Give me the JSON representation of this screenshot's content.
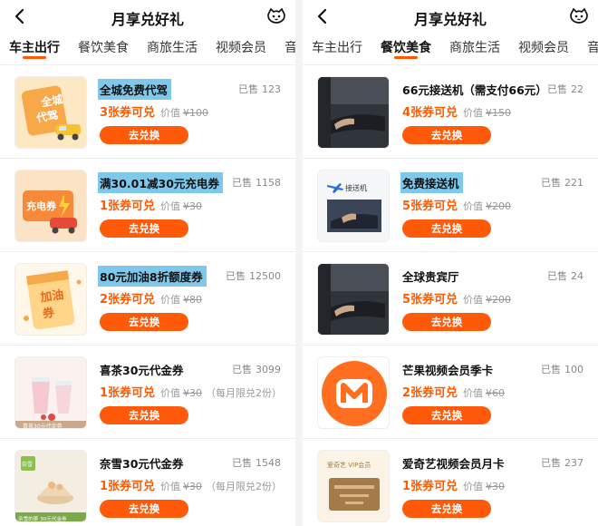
{
  "colors": {
    "accent": "#ff5a00",
    "highlight": "#7ec8ec"
  },
  "left": {
    "title": "月享兑好礼",
    "tabs": [
      "车主出行",
      "餐饮美食",
      "商旅生活",
      "视频会员",
      "音频"
    ],
    "active_tab": "车主出行",
    "items": [
      {
        "title": "全城免费代驾",
        "sold_label": "已售",
        "sold": "123",
        "coupons": "3张券可兑",
        "worth_label": "价值",
        "worth": "¥100",
        "limit": "",
        "button": "去兑换",
        "thumb_text": "全城代驾",
        "icon": "car-service-icon"
      },
      {
        "title": "满30.01减30元充电券",
        "sold_label": "已售",
        "sold": "1158",
        "coupons": "1张券可兑",
        "worth_label": "价值",
        "worth": "¥30",
        "limit": "",
        "button": "去兑换",
        "thumb_text": "充电券",
        "icon": "charging-coupon-icon"
      },
      {
        "title": "80元加油8折额度券",
        "sold_label": "已售",
        "sold": "12500",
        "coupons": "2张券可兑",
        "worth_label": "价值",
        "worth": "¥80",
        "limit": "",
        "button": "去兑换",
        "thumb_text": "加油券",
        "icon": "fuel-coupon-icon"
      },
      {
        "title": "喜茶30元代金券",
        "sold_label": "已售",
        "sold": "3099",
        "coupons": "1张券可兑",
        "worth_label": "价值",
        "worth": "¥30",
        "limit": "（每月限兑2份）",
        "button": "去兑换",
        "thumb_text": "喜茶30元代金券",
        "icon": "tea-drink-icon"
      },
      {
        "title": "奈雪30元代金券",
        "sold_label": "已售",
        "sold": "1548",
        "coupons": "1张券可兑",
        "worth_label": "价值",
        "worth": "¥30",
        "limit": "（每月限兑2份）",
        "button": "去兑换",
        "thumb_text": "奈雪的茶 30元代金券",
        "icon": "cake-icon"
      }
    ]
  },
  "right": {
    "title": "月享兑好礼",
    "tabs": [
      "车主出行",
      "餐饮美食",
      "商旅生活",
      "视频会员",
      "音频"
    ],
    "active_tab": "餐饮美食",
    "items": [
      {
        "title": "66元接送机（需支付66元）",
        "sold_label": "已售",
        "sold": "22",
        "coupons": "4张券可兑",
        "worth_label": "价值",
        "worth": "¥150",
        "limit": "",
        "button": "去兑换",
        "thumb_text": "",
        "icon": "car-door-icon"
      },
      {
        "title": "免费接送机",
        "sold_label": "已售",
        "sold": "221",
        "coupons": "5张券可兑",
        "worth_label": "价值",
        "worth": "¥200",
        "limit": "",
        "button": "去兑换",
        "thumb_text": "接送机",
        "icon": "airport-transfer-icon"
      },
      {
        "title": "全球贵宾厅",
        "sold_label": "已售",
        "sold": "24",
        "coupons": "5张券可兑",
        "worth_label": "价值",
        "worth": "¥200",
        "limit": "",
        "button": "去兑换",
        "thumb_text": "",
        "icon": "vip-lounge-icon"
      },
      {
        "title": "芒果视频会员季卡",
        "sold_label": "已售",
        "sold": "100",
        "coupons": "2张券可兑",
        "worth_label": "价值",
        "worth": "¥60",
        "limit": "",
        "button": "去兑换",
        "thumb_text": "M",
        "icon": "mango-tv-logo"
      },
      {
        "title": "爱奇艺视频会员月卡",
        "sold_label": "已售",
        "sold": "237",
        "coupons": "1张券可兑",
        "worth_label": "价值",
        "worth": "¥30",
        "limit": "",
        "button": "去兑换",
        "thumb_text": "爱奇艺 VIP会员",
        "icon": "iqiyi-card-icon"
      }
    ]
  }
}
